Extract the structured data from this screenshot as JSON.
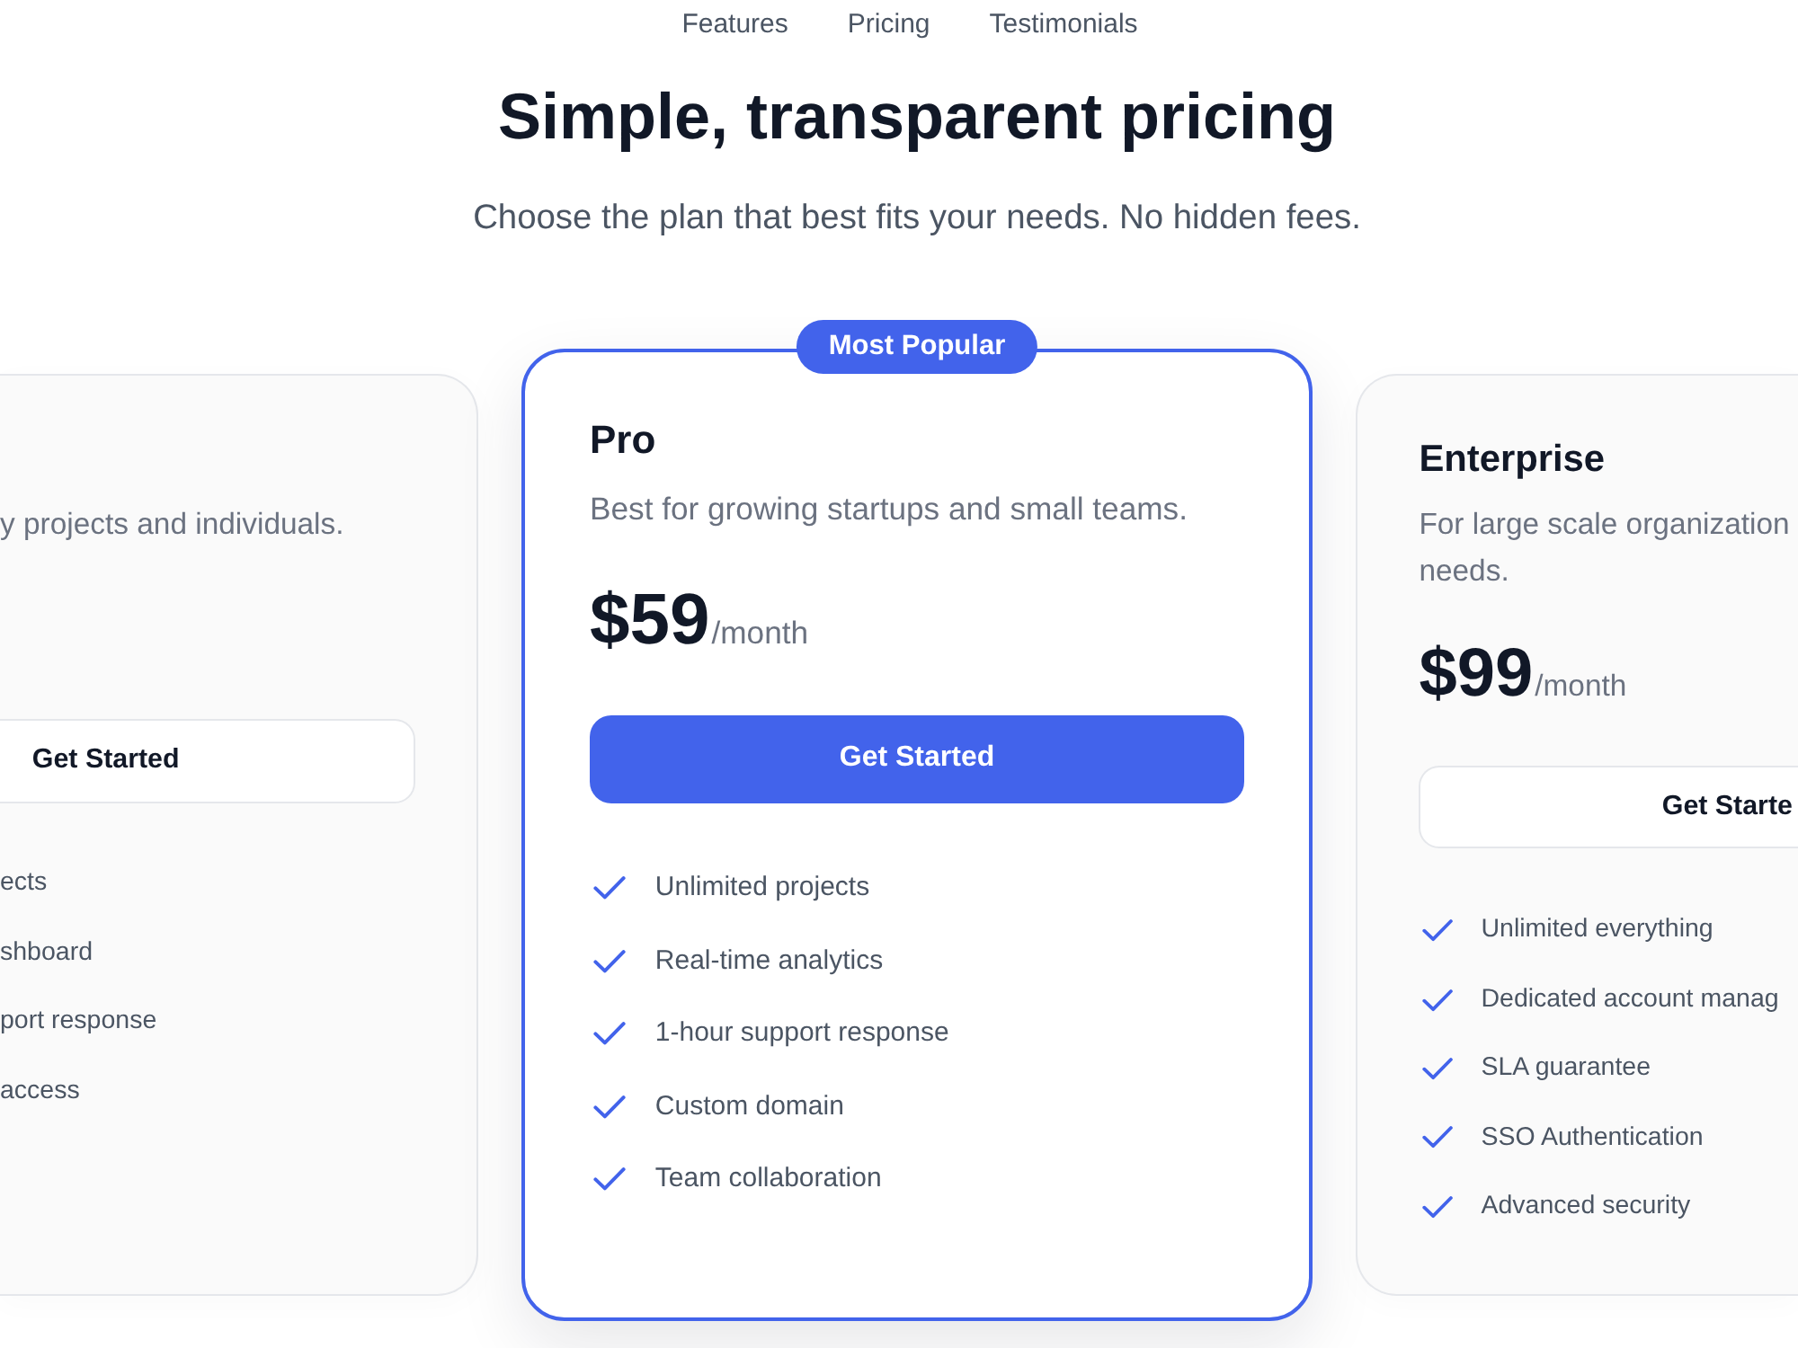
{
  "nav": [
    "Features",
    "Pricing",
    "Testimonials"
  ],
  "header": {
    "title": "Simple, transparent pricing",
    "subtitle": "Choose the plan that best fits your needs. No hidden fees."
  },
  "plans": [
    {
      "kind": "cut-left",
      "description": [
        "y projects and individuals."
      ],
      "button": "Get Started",
      "features": [
        "ects",
        "shboard",
        "port response",
        "access"
      ]
    },
    {
      "kind": "featured",
      "badge": "Most Popular",
      "name": "Pro",
      "description": [
        "Best for growing startups and small teams."
      ],
      "price": "$59",
      "period": "/month",
      "button": "Get Started",
      "features": [
        "Unlimited projects",
        "Real-time analytics",
        "1-hour support response",
        "Custom domain",
        "Team collaboration"
      ]
    },
    {
      "kind": "cut-right",
      "name": "Enterprise",
      "description": [
        "For large scale organization",
        "needs."
      ],
      "price": "$99",
      "period": "/month",
      "button": "Get Starte",
      "features": [
        "Unlimited everything",
        "Dedicated account manag",
        "SLA guarantee",
        "SSO Authentication",
        "Advanced security"
      ]
    }
  ]
}
